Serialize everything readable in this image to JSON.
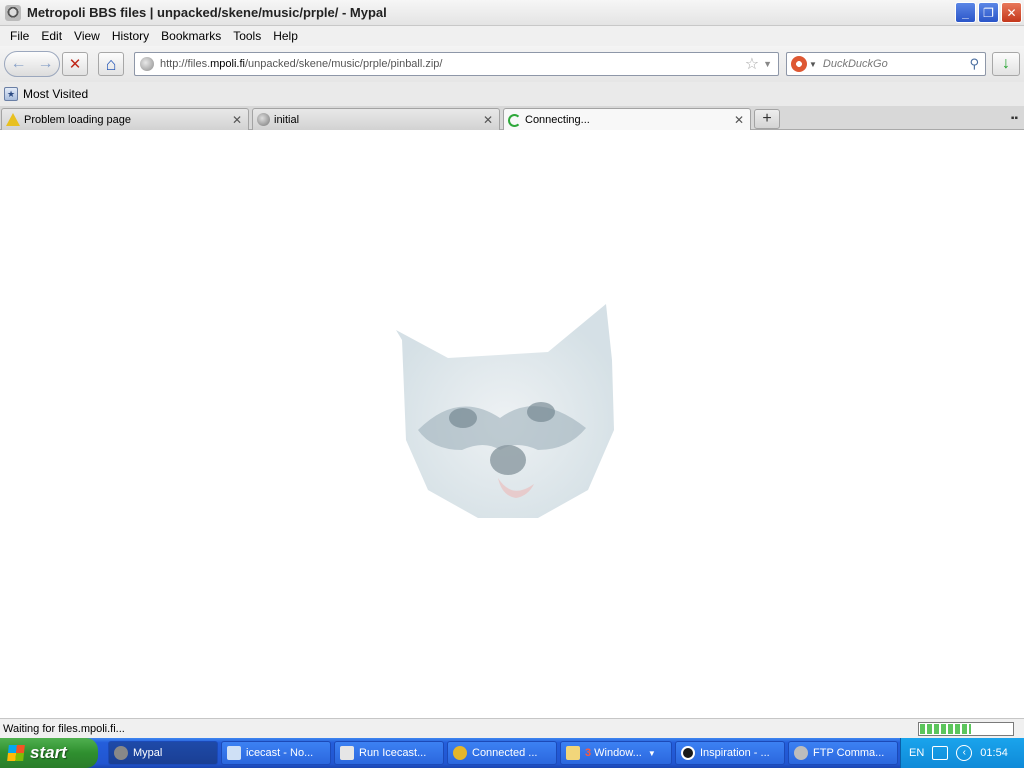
{
  "window": {
    "title": "Metropoli BBS files | unpacked/skene/music/prple/ - Mypal",
    "minimize": "_",
    "restore": "❐",
    "close": "✕"
  },
  "menu": [
    {
      "label": "File"
    },
    {
      "label": "Edit"
    },
    {
      "label": "View"
    },
    {
      "label": "History"
    },
    {
      "label": "Bookmarks"
    },
    {
      "label": "Tools"
    },
    {
      "label": "Help"
    }
  ],
  "nav": {
    "back": "←",
    "forward": "→",
    "stop": "✕",
    "home": "⌂",
    "url_prefix": "http://files.",
    "url_domain": "mpoli.fi",
    "url_path": "/unpacked/skene/music/prple/pinball.zip/",
    "search_placeholder": "DuckDuckGo",
    "download": "↓"
  },
  "bookmarks": {
    "most_visited": "Most Visited"
  },
  "tabs": [
    {
      "label": "Problem loading page",
      "icon": "warning-icon"
    },
    {
      "label": "initial",
      "icon": "globe-icon"
    },
    {
      "label": "Connecting...",
      "icon": "spinner-icon",
      "active": true
    }
  ],
  "newtab": "+",
  "status": {
    "text": "Waiting for files.mpoli.fi...",
    "progress": 0.55
  },
  "taskbar": {
    "start": "start",
    "tasks": [
      {
        "label": "Mypal",
        "active": true
      },
      {
        "label": "icecast - No..."
      },
      {
        "label": "Run Icecast..."
      },
      {
        "label": "Connected ..."
      },
      {
        "label": "Window...",
        "badge": "3"
      },
      {
        "label": "Inspiration - ..."
      },
      {
        "label": "FTP Comma..."
      }
    ],
    "language": "EN",
    "clock": "01:54"
  },
  "colors": {
    "taskbar_blue": "#245edb",
    "start_green": "#3a9d3a",
    "tray_blue": "#1590e0"
  }
}
